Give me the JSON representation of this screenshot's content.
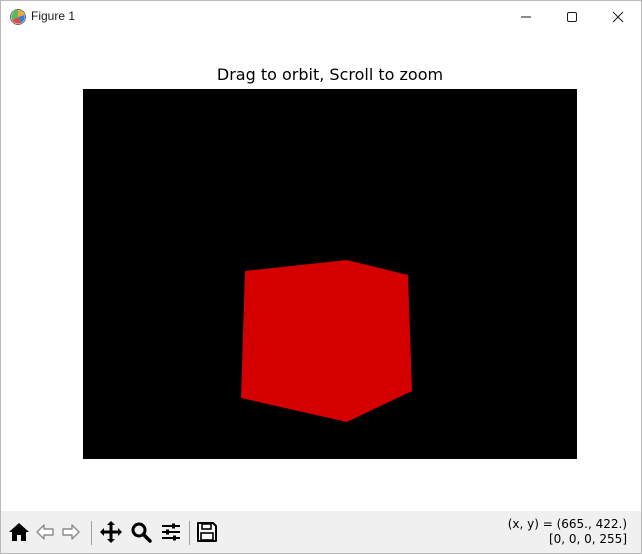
{
  "window": {
    "title": "Figure 1",
    "icons": {
      "app": "matplotlib-figure-icon",
      "minimize": "minimize-icon",
      "maximize": "maximize-icon",
      "close": "close-icon"
    }
  },
  "figure": {
    "title": "Drag to orbit, Scroll to zoom",
    "canvas_background": "#000000",
    "cube_color": "#d40000"
  },
  "toolbar": {
    "buttons": [
      {
        "name": "home-icon",
        "action": "home"
      },
      {
        "name": "back-arrow-icon",
        "action": "back"
      },
      {
        "name": "forward-arrow-icon",
        "action": "forward"
      },
      {
        "name": "pan-move-icon",
        "action": "pan"
      },
      {
        "name": "zoom-magnifier-icon",
        "action": "zoom"
      },
      {
        "name": "configure-subplots-icon",
        "action": "configure"
      },
      {
        "name": "save-floppy-icon",
        "action": "save"
      }
    ],
    "coords_line1": "(x, y) = (665., 422.)",
    "coords_line2": "[0, 0, 0, 255]"
  }
}
